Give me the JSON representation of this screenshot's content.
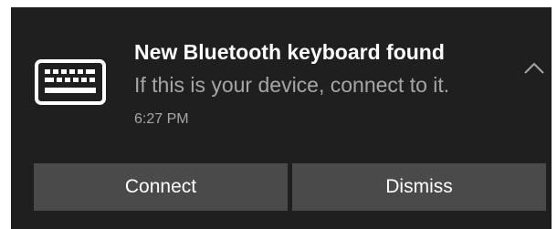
{
  "notification": {
    "icon": "keyboard-icon",
    "title": "New Bluetooth keyboard found",
    "body": "If this is your device, connect to it.",
    "timestamp": "6:27 PM",
    "collapse_icon": "chevron-up-icon",
    "actions": [
      {
        "label": "Connect"
      },
      {
        "label": "Dismiss"
      }
    ]
  },
  "colors": {
    "background": "#1f1f1f",
    "button": "#4a4a4a",
    "title_text": "#ffffff",
    "secondary_text": "#a6a6a6"
  }
}
